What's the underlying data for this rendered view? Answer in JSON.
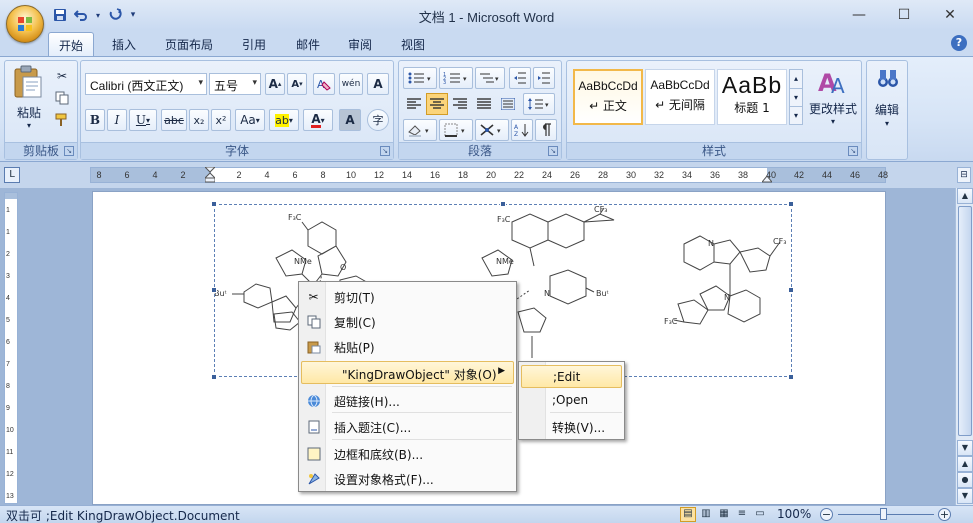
{
  "app": {
    "title": "文档 1 - Microsoft Word"
  },
  "window_controls": {
    "minimize": "—",
    "maximize": "☐",
    "close": "✕"
  },
  "qat": {
    "save_icon": "save-icon",
    "undo_icon": "undo-icon",
    "redo_icon": "redo-icon",
    "customize_icon": "customize-qat-icon"
  },
  "tabs": [
    {
      "label": "开始",
      "active": true
    },
    {
      "label": "插入"
    },
    {
      "label": "页面布局"
    },
    {
      "label": "引用"
    },
    {
      "label": "邮件"
    },
    {
      "label": "审阅"
    },
    {
      "label": "视图"
    }
  ],
  "help": "?",
  "clipboard": {
    "group_label": "剪贴板",
    "paste_label": "粘贴"
  },
  "font": {
    "group_label": "字体",
    "font_name": "Calibri (西文正文)",
    "font_size": "五号",
    "grow_label": "A",
    "shrink_label": "A",
    "bold": "B",
    "italic": "I",
    "underline": "U",
    "strikethrough": "abc",
    "subscript": "x₂",
    "superscript": "x²",
    "change_case": "Aa",
    "phonetic": "wén",
    "enclose": "A",
    "char_border": "字",
    "highlight": "ab",
    "font_color": "A",
    "char_shade": "A",
    "enclose_char": "字"
  },
  "paragraph": {
    "group_label": "段落"
  },
  "styles": {
    "group_label": "样式",
    "items": [
      {
        "sample": "AaBbCcDd",
        "name": "↵ 正文",
        "selected": true
      },
      {
        "sample": "AaBbCcDd",
        "name": "↵ 无间隔"
      },
      {
        "sample": "AaBb",
        "name": "标题 1"
      }
    ],
    "change_styles_label": "更改样式"
  },
  "editing": {
    "label": "编辑"
  },
  "ruler": {
    "ticks": [
      "8",
      "6",
      "4",
      "2",
      "",
      "2",
      "4",
      "6",
      "8",
      "10",
      "12",
      "14",
      "16",
      "18",
      "20",
      "22",
      "24",
      "26",
      "28",
      "30",
      "32",
      "34",
      "36",
      "38",
      "40",
      "42",
      "44",
      "46",
      "48"
    ]
  },
  "vruler": {
    "ticks": [
      "1",
      "1",
      "2",
      "3",
      "4",
      "5",
      "6",
      "7",
      "8",
      "9",
      "10",
      "11",
      "12",
      "13"
    ]
  },
  "molecule": {
    "cf3": "F₃C",
    "cf3_right": "CF₃",
    "nme": "NMe",
    "but": "Buᵗ",
    "n": "N",
    "o": "O"
  },
  "context_menu": {
    "items": [
      {
        "label": "剪切(T)",
        "icon": "scissors-icon"
      },
      {
        "label": "复制(C)",
        "icon": "copy-icon"
      },
      {
        "label": "粘贴(P)",
        "icon": "paste-icon"
      },
      {
        "label": "\"KingDrawObject\" 对象(O)",
        "icon": "",
        "submenu": true
      },
      {
        "label": "超链接(H)...",
        "icon": "hyperlink-icon"
      },
      {
        "label": "插入题注(C)...",
        "icon": "caption-icon"
      },
      {
        "label": "边框和底纹(B)...",
        "icon": "borders-icon"
      },
      {
        "label": "设置对象格式(F)...",
        "icon": "format-object-icon"
      }
    ]
  },
  "submenu": {
    "items": [
      {
        "label": ";Edit"
      },
      {
        "label": ";Open"
      },
      {
        "label": "转换(V)..."
      }
    ]
  },
  "status": {
    "text": "双击可 ;Edit KingDrawObject.Document",
    "zoom": "100%",
    "zoom_minus": "−",
    "zoom_plus": "+"
  },
  "colors": {
    "accent": "#3d6fc0",
    "highlight_yellow": "#ffe8a6",
    "font_red": "#e02020"
  }
}
